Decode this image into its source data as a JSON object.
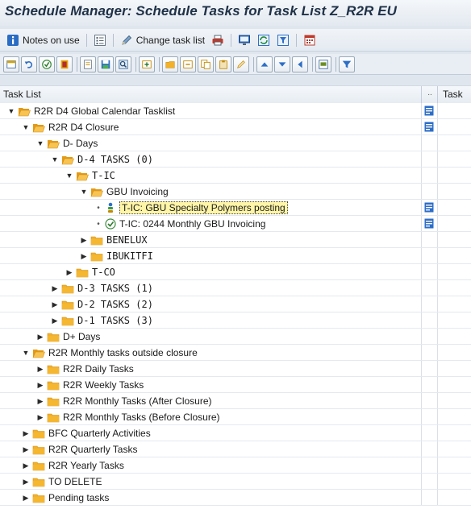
{
  "window": {
    "title": "Schedule Manager: Schedule Tasks for Task List Z_R2R EU"
  },
  "app_toolbar": {
    "items": [
      {
        "icon": "info-icon",
        "label": "Notes on use"
      },
      {
        "icon": "list-icon",
        "label": ""
      },
      {
        "icon": "pencil-icon",
        "label": "Change task list"
      },
      {
        "icon": "print-icon",
        "label": ""
      },
      {
        "icon": "monitor-icon",
        "label": ""
      },
      {
        "icon": "refresh-icon",
        "label": ""
      },
      {
        "icon": "filter-icon",
        "label": ""
      },
      {
        "icon": "calendar-icon",
        "label": ""
      }
    ]
  },
  "grid_toolbar": {
    "buttons": [
      "layout-icon",
      "undo-icon",
      "execute-icon",
      "stop-icon",
      "detail-icon",
      "save-icon",
      "search-icon",
      "insert-icon",
      "folder-new-icon",
      "delete-icon",
      "copy-icon",
      "paste-icon",
      "edit-icon",
      "move-up-icon",
      "move-down-icon",
      "move-left-icon",
      "print-list-icon",
      "filter-icon"
    ]
  },
  "columns": {
    "task_list": "Task List",
    "small": "..",
    "task": "Task"
  },
  "tree": [
    {
      "label": "R2R D4 Global Calendar Tasklist",
      "level": 0,
      "type": "folder",
      "expanded": true,
      "doc": true
    },
    {
      "label": "R2R D4 Closure",
      "level": 1,
      "type": "folder",
      "expanded": true,
      "doc": true
    },
    {
      "label": "D- Days",
      "level": 2,
      "type": "folder",
      "expanded": true,
      "doc": false
    },
    {
      "label": "D-4 TASKS (0)",
      "level": 3,
      "type": "folder",
      "expanded": true,
      "doc": false,
      "mono": true
    },
    {
      "label": "T-IC",
      "level": 4,
      "type": "folder",
      "expanded": true,
      "doc": false,
      "mono": true
    },
    {
      "label": "GBU Invoicing",
      "level": 5,
      "type": "folder",
      "expanded": true,
      "doc": false
    },
    {
      "label": "T-IC: GBU Specialty Polymers posting",
      "level": 6,
      "type": "task-person",
      "doc": true,
      "selected": true
    },
    {
      "label": "T-IC: 0244 Monthly GBU Invoicing",
      "level": 6,
      "type": "task-program",
      "doc": true
    },
    {
      "label": "BENELUX",
      "level": 5,
      "type": "folder",
      "expanded": false,
      "doc": false,
      "mono": true
    },
    {
      "label": "IBUKITFI",
      "level": 5,
      "type": "folder",
      "expanded": false,
      "doc": false,
      "mono": true
    },
    {
      "label": "T-CO",
      "level": 4,
      "type": "folder",
      "expanded": false,
      "doc": false,
      "mono": true
    },
    {
      "label": "D-3 TASKS (1)",
      "level": 3,
      "type": "folder",
      "expanded": false,
      "doc": false,
      "mono": true
    },
    {
      "label": "D-2 TASKS (2)",
      "level": 3,
      "type": "folder",
      "expanded": false,
      "doc": false,
      "mono": true
    },
    {
      "label": "D-1 TASKS (3)",
      "level": 3,
      "type": "folder",
      "expanded": false,
      "doc": false,
      "mono": true
    },
    {
      "label": "D+ Days",
      "level": 2,
      "type": "folder",
      "expanded": false,
      "doc": false
    },
    {
      "label": "R2R Monthly tasks outside closure",
      "level": 1,
      "type": "folder",
      "expanded": true,
      "doc": false
    },
    {
      "label": "R2R Daily Tasks",
      "level": 2,
      "type": "folder",
      "expanded": false,
      "doc": false
    },
    {
      "label": "R2R Weekly Tasks",
      "level": 2,
      "type": "folder",
      "expanded": false,
      "doc": false
    },
    {
      "label": "R2R Monthly Tasks (After Closure)",
      "level": 2,
      "type": "folder",
      "expanded": false,
      "doc": false
    },
    {
      "label": "R2R Monthly Tasks (Before Closure)",
      "level": 2,
      "type": "folder",
      "expanded": false,
      "doc": false
    },
    {
      "label": "BFC Quarterly Activities",
      "level": 1,
      "type": "folder",
      "expanded": false,
      "doc": false
    },
    {
      "label": "R2R Quarterly Tasks",
      "level": 1,
      "type": "folder",
      "expanded": false,
      "doc": false
    },
    {
      "label": "R2R Yearly Tasks",
      "level": 1,
      "type": "folder",
      "expanded": false,
      "doc": false
    },
    {
      "label": "TO DELETE",
      "level": 1,
      "type": "folder",
      "expanded": false,
      "doc": false
    },
    {
      "label": "Pending tasks",
      "level": 1,
      "type": "folder",
      "expanded": false,
      "doc": false
    }
  ],
  "colors": {
    "folder": "#f2b12b",
    "folder_open": "#f7c453",
    "accent": "#1f3147",
    "selection": "#fff5a8"
  }
}
